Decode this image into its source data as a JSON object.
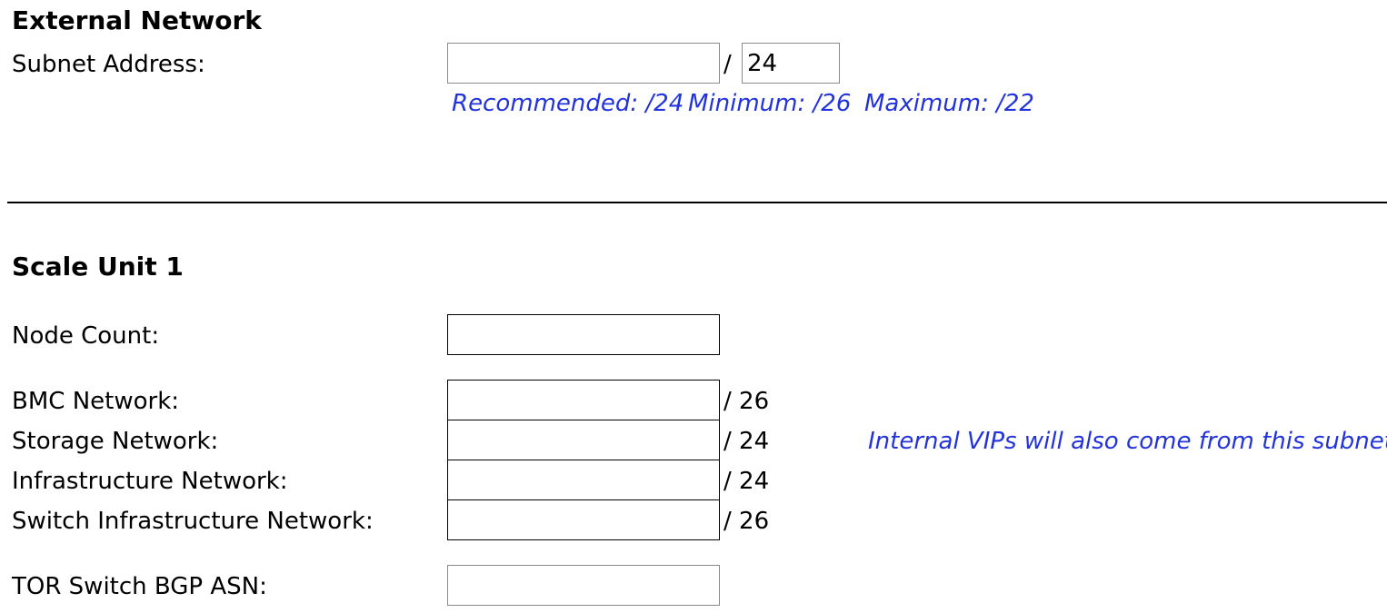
{
  "external_network": {
    "heading": "External Network",
    "subnet_label": "Subnet Address:",
    "subnet_value": "",
    "prefix_separator": "/",
    "prefix_value": "24",
    "hint_recommended": "Recommended: /24",
    "hint_minimum": "Minimum: /26",
    "hint_maximum": "Maximum: /22"
  },
  "scale_unit": {
    "heading": "Scale Unit 1",
    "node_count": {
      "label": "Node Count:",
      "value": ""
    },
    "networks": [
      {
        "label": "BMC Network:",
        "value": "",
        "prefix": "/  26"
      },
      {
        "label": "Storage Network:",
        "value": "",
        "prefix": "/  24",
        "note": "Internal VIPs will also come from this subnet"
      },
      {
        "label": "Infrastructure Network:",
        "value": "",
        "prefix": "/  24"
      },
      {
        "label": "Switch Infrastructure Network:",
        "value": "",
        "prefix": "/  26"
      }
    ],
    "tor_asn": {
      "label": "TOR Switch BGP ASN:",
      "value": ""
    }
  },
  "colors": {
    "hint": "#2233dd",
    "text": "#000000",
    "field_border": "#000000",
    "field_border_light": "#8a8a8a"
  }
}
